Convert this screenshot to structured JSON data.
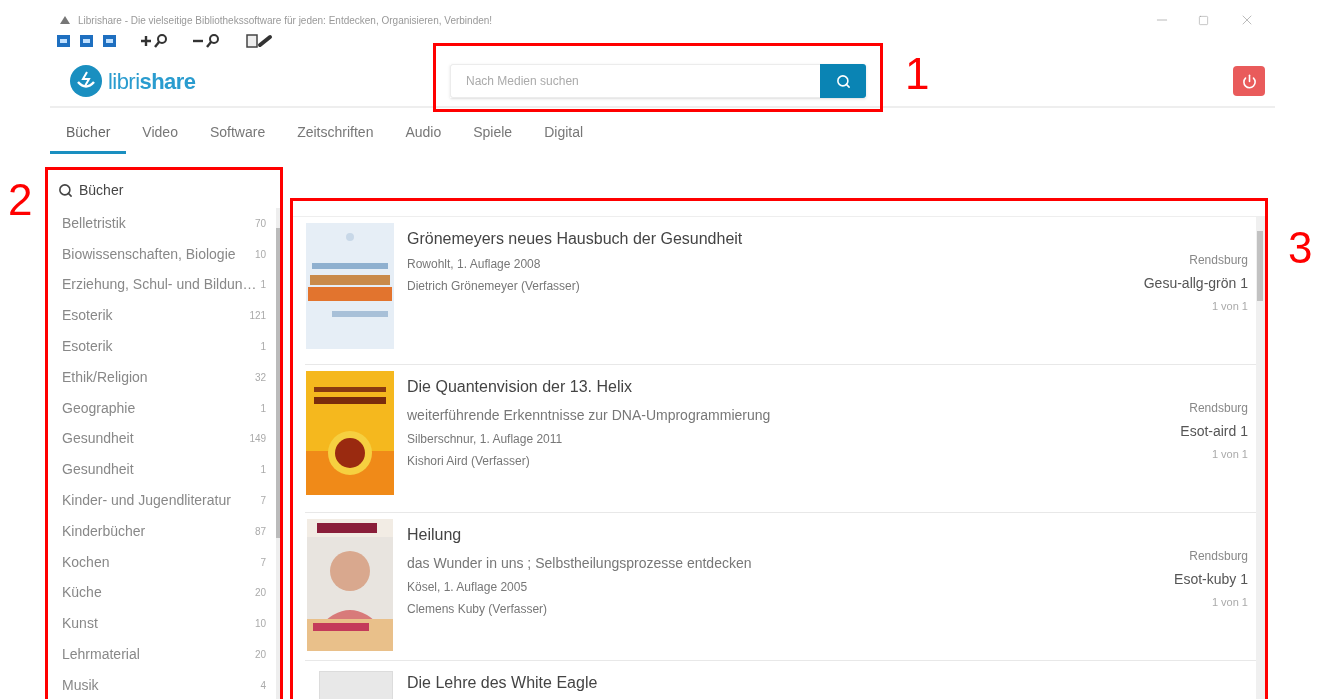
{
  "window": {
    "title": "Librishare - Die vielseitige Bibliothekssoftware für jeden: Entdecken, Organisieren, Verbinden!"
  },
  "logo": {
    "light": "libri",
    "bold": "share"
  },
  "search": {
    "placeholder": "Nach Medien suchen"
  },
  "tabs": [
    {
      "label": "Bücher",
      "selected": true
    },
    {
      "label": "Video",
      "selected": false
    },
    {
      "label": "Software",
      "selected": false
    },
    {
      "label": "Zeitschriften",
      "selected": false
    },
    {
      "label": "Audio",
      "selected": false
    },
    {
      "label": "Spiele",
      "selected": false
    },
    {
      "label": "Digital",
      "selected": false
    }
  ],
  "sidebar": {
    "title": "Bücher",
    "items": [
      {
        "label": "Belletristik",
        "count": "70"
      },
      {
        "label": "Biowissenschaften, Biologie",
        "count": "10"
      },
      {
        "label": "Erziehung, Schul- und Bildun…",
        "count": "1"
      },
      {
        "label": "Esoterik",
        "count": "121"
      },
      {
        "label": "Esoterik",
        "count": "1"
      },
      {
        "label": "Ethik/Religion",
        "count": "32"
      },
      {
        "label": "Geographie",
        "count": "1"
      },
      {
        "label": "Gesundheit",
        "count": "149"
      },
      {
        "label": "Gesundheit",
        "count": "1"
      },
      {
        "label": "Kinder- und Jugendliteratur",
        "count": "7"
      },
      {
        "label": "Kinderbücher",
        "count": "87"
      },
      {
        "label": "Kochen",
        "count": "7"
      },
      {
        "label": "Küche",
        "count": "20"
      },
      {
        "label": "Kunst",
        "count": "10"
      },
      {
        "label": "Lehrmaterial",
        "count": "20"
      },
      {
        "label": "Musik",
        "count": "4"
      }
    ]
  },
  "results": [
    {
      "title": "Grönemeyers neues Hausbuch der Gesundheit",
      "kind": "picture",
      "lines": [
        "Rowohlt, 1. Auflage 2008",
        "Dietrich Grönemeyer (Verfasser)"
      ],
      "location": "Rendsburg",
      "signature": "Gesu-allg-grön 1",
      "availability": "1 von 1"
    },
    {
      "title": "Die Quantenvision der 13. Helix",
      "kind": "picture",
      "lines": [
        "weiterführende Erkenntnisse zur DNA-Umprogrammierung",
        "Silberschnur, 1. Auflage 2011",
        "Kishori Aird (Verfasser)"
      ],
      "location": "Rendsburg",
      "signature": "Esot-aird 1",
      "availability": "1 von 1"
    },
    {
      "title": "Heilung",
      "kind": "picture",
      "lines": [
        "das Wunder in uns ; Selbstheilungsprozesse entdecken",
        "Kösel, 1. Auflage 2005",
        "Clemens Kuby (Verfasser)"
      ],
      "location": "Rendsburg",
      "signature": "Esot-kuby 1",
      "availability": "1 von 1"
    },
    {
      "title": "Die Lehre des White Eagle",
      "kind": "placeholder"
    }
  ],
  "callouts": [
    {
      "label": "1"
    },
    {
      "label": "2"
    },
    {
      "label": "3"
    }
  ]
}
